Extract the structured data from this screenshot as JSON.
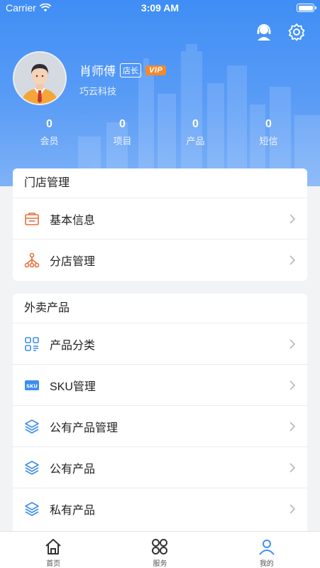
{
  "status_bar": {
    "carrier": "Carrier",
    "time": "3:09 AM"
  },
  "header": {
    "icons": [
      "headset-icon",
      "gear-icon"
    ],
    "user": {
      "name": "肖师傅",
      "role_tag": "店长",
      "vip_tag": "VIP",
      "company": "巧云科技"
    },
    "stats": [
      {
        "value": "0",
        "label": "会员"
      },
      {
        "value": "0",
        "label": "项目"
      },
      {
        "value": "0",
        "label": "产品"
      },
      {
        "value": "0",
        "label": "短信"
      }
    ]
  },
  "sections": [
    {
      "title": "门店管理",
      "items": [
        {
          "label": "基本信息",
          "icon": "store-info-icon"
        },
        {
          "label": "分店管理",
          "icon": "branch-icon"
        }
      ]
    },
    {
      "title": "外卖产品",
      "items": [
        {
          "label": "产品分类",
          "icon": "category-icon"
        },
        {
          "label": "SKU管理",
          "icon": "sku-icon"
        },
        {
          "label": "公有产品管理",
          "icon": "layers-icon"
        },
        {
          "label": "公有产品",
          "icon": "layers-icon"
        },
        {
          "label": "私有产品",
          "icon": "layers-icon"
        }
      ]
    }
  ],
  "tabbar": [
    {
      "label": "首页",
      "icon": "home-icon"
    },
    {
      "label": "服务",
      "icon": "grid-icon"
    },
    {
      "label": "我的",
      "icon": "profile-icon"
    }
  ],
  "colors": {
    "accent": "#3f8ef5",
    "icon_orange": "#e8703a",
    "icon_blue": "#3c8df0",
    "vip": "#f08a2d"
  }
}
